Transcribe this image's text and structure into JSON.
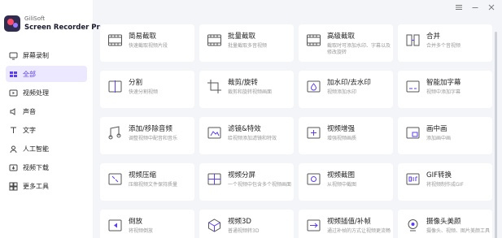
{
  "app": {
    "brand": "GiliSoft",
    "name": "Screen Recorder Pro"
  },
  "sidebar": {
    "items": [
      {
        "label": "屏幕录制",
        "icon": "monitor-icon"
      },
      {
        "label": "全部",
        "icon": "folder-icon",
        "active": true
      },
      {
        "label": "视频处理",
        "icon": "video-process-icon"
      },
      {
        "label": "声音",
        "icon": "sound-icon"
      },
      {
        "label": "文字",
        "icon": "text-icon"
      },
      {
        "label": "人工智能",
        "icon": "ai-icon"
      },
      {
        "label": "视频下载",
        "icon": "download-icon"
      },
      {
        "label": "更多工具",
        "icon": "tools-icon"
      }
    ]
  },
  "cards": [
    {
      "title": "简易截取",
      "desc": "快速截取视频片段",
      "icon": "film-icon"
    },
    {
      "title": "批量截取",
      "desc": "批量截取多音视频",
      "icon": "film-icon"
    },
    {
      "title": "高级截取",
      "desc": "截取时可添加水印、字幕以及修改旋转",
      "icon": "film-icon"
    },
    {
      "title": "合并",
      "desc": "合并多个音视频",
      "icon": "merge-icon"
    },
    {
      "title": "分割",
      "desc": "快速分割视频",
      "icon": "split-icon"
    },
    {
      "title": "裁剪/旋转",
      "desc": "裁剪和旋转视频画面",
      "icon": "crop-icon"
    },
    {
      "title": "加水印/去水印",
      "desc": "视频添加水印",
      "icon": "watermark-icon"
    },
    {
      "title": "智能加字幕",
      "desc": "视频中添加字幕",
      "icon": "subtitle-icon"
    },
    {
      "title": "添加/移除音频",
      "desc": "调整视频中配音和音乐",
      "icon": "audio-icon"
    },
    {
      "title": "滤镜&特效",
      "desc": "给视频添加滤镜和特效",
      "icon": "filter-icon"
    },
    {
      "title": "视频增强",
      "desc": "增强视频画质",
      "icon": "enhance-icon"
    },
    {
      "title": "画中画",
      "desc": "添加画中画",
      "icon": "pip-icon"
    },
    {
      "title": "视频压缩",
      "desc": "压缩视频文件保持质量",
      "icon": "compress-icon"
    },
    {
      "title": "视频分屏",
      "desc": "一个视频中包含多个视频画面",
      "icon": "splitscreen-icon"
    },
    {
      "title": "视频截图",
      "desc": "从视频中截图",
      "icon": "screenshot-icon"
    },
    {
      "title": "GIF转换",
      "desc": "将视频制作成GIF",
      "icon": "gif-icon"
    },
    {
      "title": "倒放",
      "desc": "将视频倒放",
      "icon": "reverse-icon"
    },
    {
      "title": "视频3D",
      "desc": "普通视频转3D",
      "icon": "3d-icon"
    },
    {
      "title": "视频插值/补帧",
      "desc": "通过补帧的方式让视频更流畅",
      "icon": "interpolate-icon"
    },
    {
      "title": "摄像头美颜",
      "desc": "摄像头、视频、图片美颜工具",
      "icon": "webcam-icon"
    }
  ]
}
